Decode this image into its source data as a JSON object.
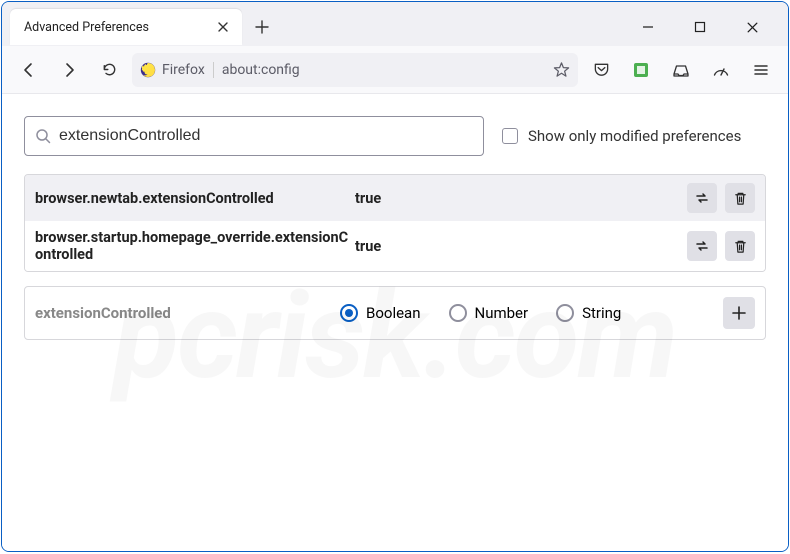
{
  "window": {
    "tab_title": "Advanced Preferences"
  },
  "toolbar": {
    "identity_label": "Firefox",
    "url": "about:config"
  },
  "search": {
    "value": "extensionControlled",
    "modified_label": "Show only modified preferences"
  },
  "prefs": [
    {
      "name": "browser.newtab.extensionControlled",
      "value": "true"
    },
    {
      "name": "browser.startup.homepage_override.extensionControlled",
      "value": "true"
    }
  ],
  "new_pref": {
    "name": "extensionControlled",
    "types": [
      "Boolean",
      "Number",
      "String"
    ],
    "selected": 0
  },
  "watermark": "pcrisk.com"
}
